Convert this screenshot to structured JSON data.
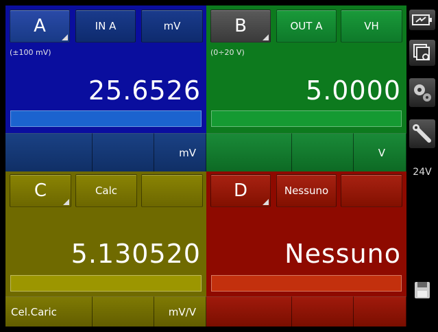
{
  "panels": {
    "a": {
      "channel": "A",
      "function": "IN A",
      "unit_button": "mV",
      "range": "(±100 mV)",
      "value": "25.6526",
      "footer_unit": "mV",
      "color": "#0a0e9e"
    },
    "b": {
      "channel": "B",
      "function": "OUT A",
      "unit_button": "VH",
      "range": "(0÷20 V)",
      "value": "5.0000",
      "footer_unit": "V",
      "color": "#0d7a1e"
    },
    "c": {
      "channel": "C",
      "function": "Calc",
      "unit_button": "",
      "range": "",
      "value": "5.130520",
      "footer_left": "Cel.Caric",
      "footer_unit": "mV/V",
      "color": "#6f6a00"
    },
    "d": {
      "channel": "D",
      "function": "Nessuno",
      "unit_button": "",
      "range": "",
      "value": "Nessuno",
      "footer_unit": "",
      "color": "#8e0a00"
    }
  },
  "sidebar": {
    "icons": [
      "battery-icon",
      "window-settings-icon",
      "gears-icon",
      "wrench-icon",
      "save-icon"
    ],
    "supply_label": "24V"
  }
}
